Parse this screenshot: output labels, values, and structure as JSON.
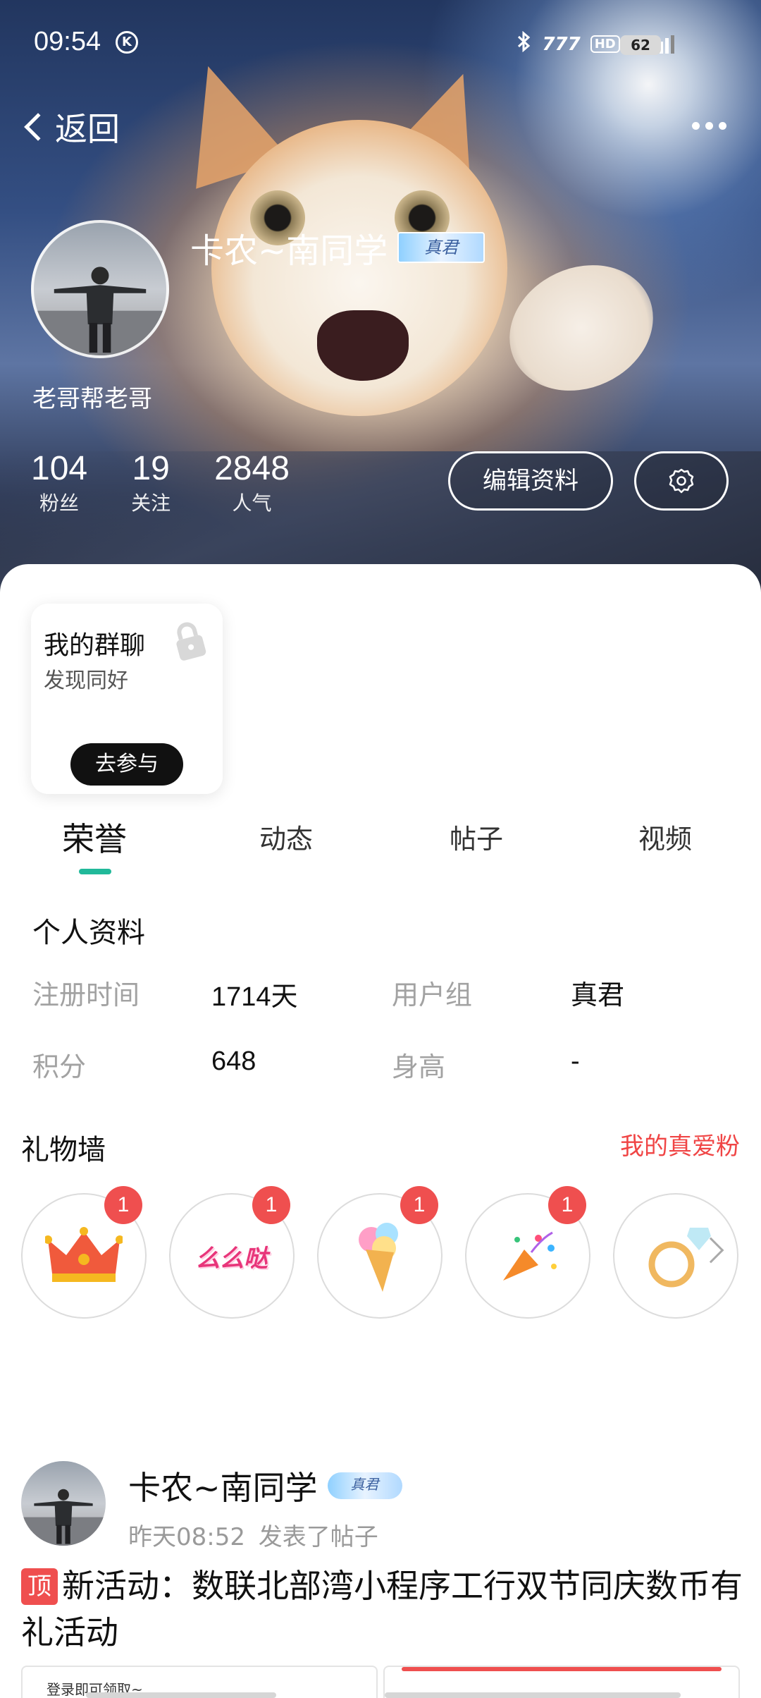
{
  "status_bar": {
    "time": "09:54",
    "k_icon": "K",
    "network": "4G",
    "hd": "HD",
    "battery": "62"
  },
  "nav": {
    "back_label": "返回",
    "more_icon": "more-dots-icon"
  },
  "profile": {
    "username": "卡农~南同学",
    "rank_badge": "真君",
    "signature": "老哥帮老哥",
    "stats": [
      {
        "value": "104",
        "label": "粉丝"
      },
      {
        "value": "19",
        "label": "关注"
      },
      {
        "value": "2848",
        "label": "人气"
      }
    ],
    "edit_button": "编辑资料",
    "settings_icon": "gear-icon"
  },
  "group_chat": {
    "title": "我的群聊",
    "subtitle": "发现同好",
    "button": "去参与"
  },
  "tabs": [
    {
      "label": "荣誉",
      "active": true
    },
    {
      "label": "动态",
      "active": false
    },
    {
      "label": "帖子",
      "active": false
    },
    {
      "label": "视频",
      "active": false
    }
  ],
  "personal_info": {
    "title": "个人资料",
    "fields": [
      {
        "label": "注册时间",
        "value": "1714天"
      },
      {
        "label": "用户组",
        "value": "真君"
      },
      {
        "label": "积分",
        "value": "648"
      },
      {
        "label": "身高",
        "value": "-"
      }
    ]
  },
  "gift_wall": {
    "title": "礼物墙",
    "link": "我的真爱粉",
    "gifts": [
      {
        "icon": "crown-icon",
        "count": "1"
      },
      {
        "icon": "memeda-sticker-icon",
        "text": "么么哒",
        "count": "1"
      },
      {
        "icon": "ice-cream-icon",
        "count": "1"
      },
      {
        "icon": "party-popper-icon",
        "count": "1"
      },
      {
        "icon": "diamond-ring-icon",
        "count": ""
      }
    ]
  },
  "post": {
    "author": "卡农~南同学",
    "rank_badge": "真君",
    "time": "昨天08:52",
    "action": "发表了帖子",
    "top_tag": "顶",
    "title": "新活动：数联北部湾小程序工行双节同庆数币有礼活动",
    "card_text": "登录即可领取~"
  },
  "colors": {
    "accent_green": "#21b99a",
    "accent_red": "#ef4f4f",
    "link_red": "#f04545"
  }
}
